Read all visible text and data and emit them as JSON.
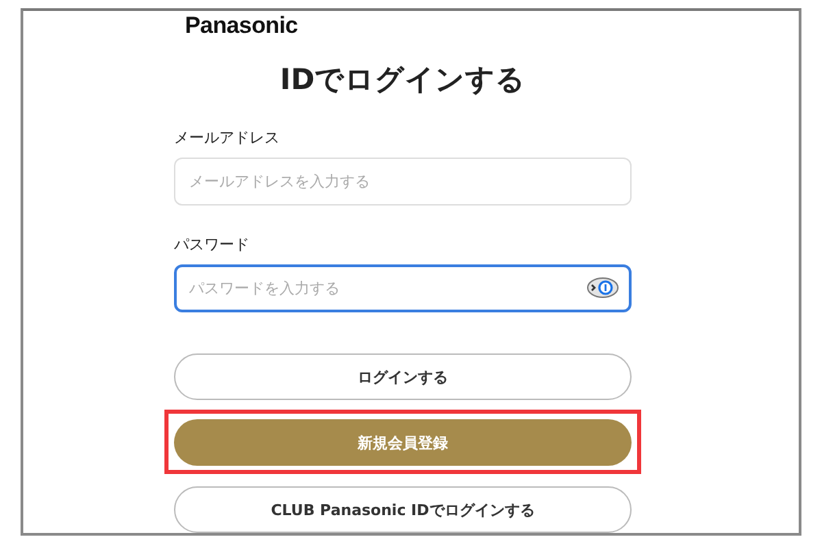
{
  "logo": "Panasonic",
  "title": "IDでログインする",
  "fields": [
    {
      "label": "メールアドレス",
      "placeholder": "メールアドレスを入力する",
      "focused": false,
      "kind": "text"
    },
    {
      "label": "パスワード",
      "placeholder": "パスワードを入力する",
      "focused": true,
      "kind": "password"
    }
  ],
  "buttons": [
    {
      "label": "ログインする",
      "kind": "outline",
      "highlighted": false
    },
    {
      "label": "新規会員登録",
      "kind": "primary",
      "highlighted": true
    },
    {
      "label": "CLUB Panasonic IDでログインする",
      "kind": "outline",
      "highlighted": false
    }
  ]
}
